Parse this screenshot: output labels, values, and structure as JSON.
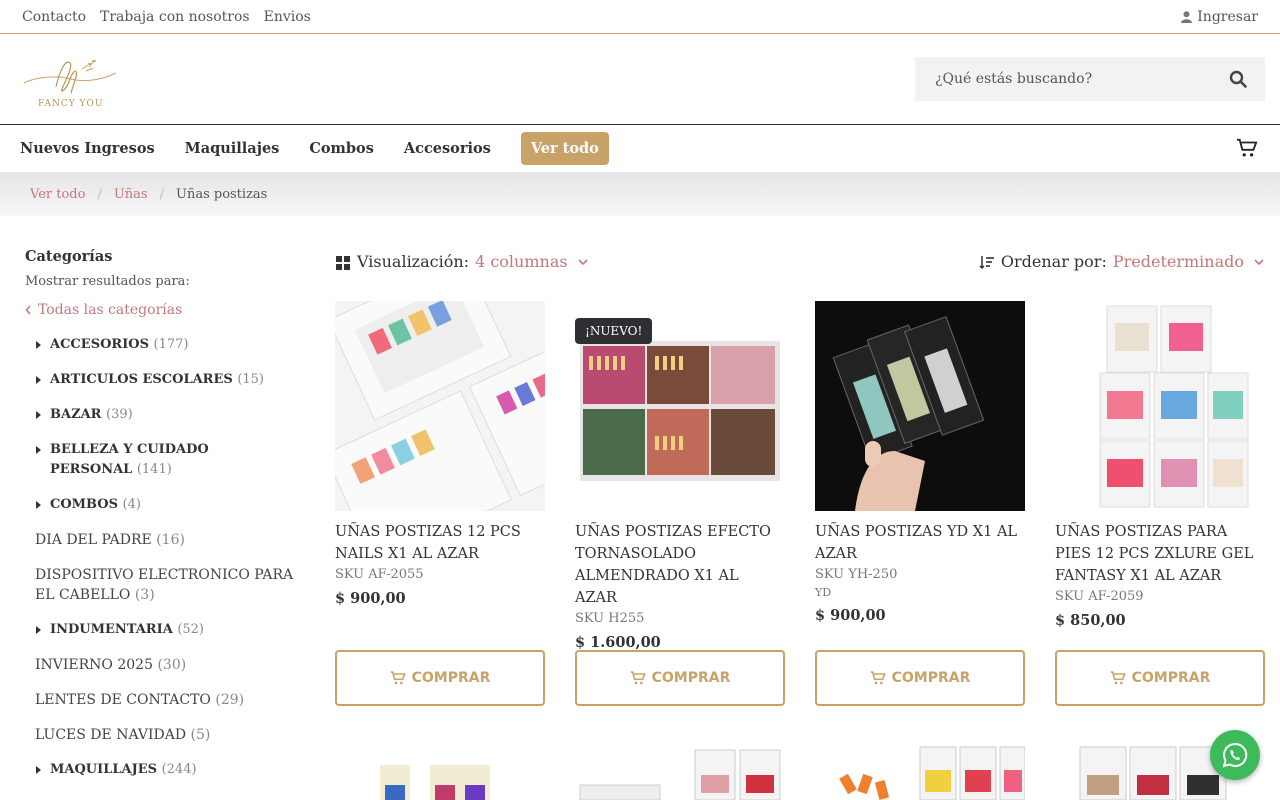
{
  "topbar": {
    "links": [
      "Contacto",
      "Trabaja con nosotros",
      "Envios"
    ],
    "login": "Ingresar"
  },
  "logo": {
    "text": "FANCY YOU"
  },
  "search": {
    "placeholder": "¿Qué estás buscando?"
  },
  "nav": {
    "items": [
      "Nuevos Ingresos",
      "Maquillajes",
      "Combos",
      "Accesorios"
    ],
    "ver_todo": "Ver todo"
  },
  "breadcrumb": {
    "items": [
      "Ver todo",
      "Uñas",
      "Uñas postizas"
    ]
  },
  "sidebar": {
    "title": "Categorías",
    "subtitle": "Mostrar resultados para:",
    "all_link": "Todas las categorías",
    "categories": [
      {
        "name": "ACCESORIOS",
        "count": "(177)"
      },
      {
        "name": "ARTICULOS ESCOLARES",
        "count": "(15)"
      },
      {
        "name": "BAZAR",
        "count": "(39)"
      },
      {
        "name": "BELLEZA Y CUIDADO PERSONAL",
        "count": "(141)"
      },
      {
        "name": "COMBOS",
        "count": "(4)"
      },
      {
        "name": "DIA DEL PADRE",
        "count": "(16)"
      },
      {
        "name": "DISPOSITIVO ELECTRONICO PARA EL CABELLO",
        "count": "(3)"
      },
      {
        "name": "INDUMENTARIA",
        "count": "(52)"
      },
      {
        "name": "INVIERNO 2025",
        "count": "(30)"
      },
      {
        "name": "LENTES DE CONTACTO",
        "count": "(29)"
      },
      {
        "name": "LUCES DE NAVIDAD",
        "count": "(5)"
      },
      {
        "name": "MAQUILLAJES",
        "count": "(244)"
      }
    ]
  },
  "toolbar": {
    "view_label": "Visualización:",
    "view_value": "4 columnas",
    "sort_label": "Ordenar por:",
    "sort_value": "Predeterminado"
  },
  "products": [
    {
      "name": "UÑAS POSTIZAS 12 PCS NAILS X1 AL AZAR",
      "sku": "SKU AF-2055",
      "brand": "",
      "price": "$  900,00",
      "badge": "",
      "buy": "COMPRAR"
    },
    {
      "name": "UÑAS POSTIZAS EFECTO TORNASOLADO ALMENDRADO X1 AL AZAR",
      "sku": "SKU H255",
      "brand": "",
      "price": "$  1.600,00",
      "badge": "¡NUEVO!",
      "buy": "COMPRAR"
    },
    {
      "name": "UÑAS POSTIZAS YD X1 AL AZAR",
      "sku": "SKU YH-250",
      "brand": "YD",
      "price": "$  900,00",
      "badge": "",
      "buy": "COMPRAR"
    },
    {
      "name": "UÑAS POSTIZAS PARA PIES 12 PCS ZXLURE GEL FANTASY X1 AL AZAR",
      "sku": "SKU AF-2059",
      "brand": "",
      "price": "$  850,00",
      "badge": "",
      "buy": "COMPRAR"
    }
  ],
  "colors": {
    "accent": "#c9a26a",
    "link": "#c4777a",
    "whatsapp": "#3dbb5a"
  }
}
